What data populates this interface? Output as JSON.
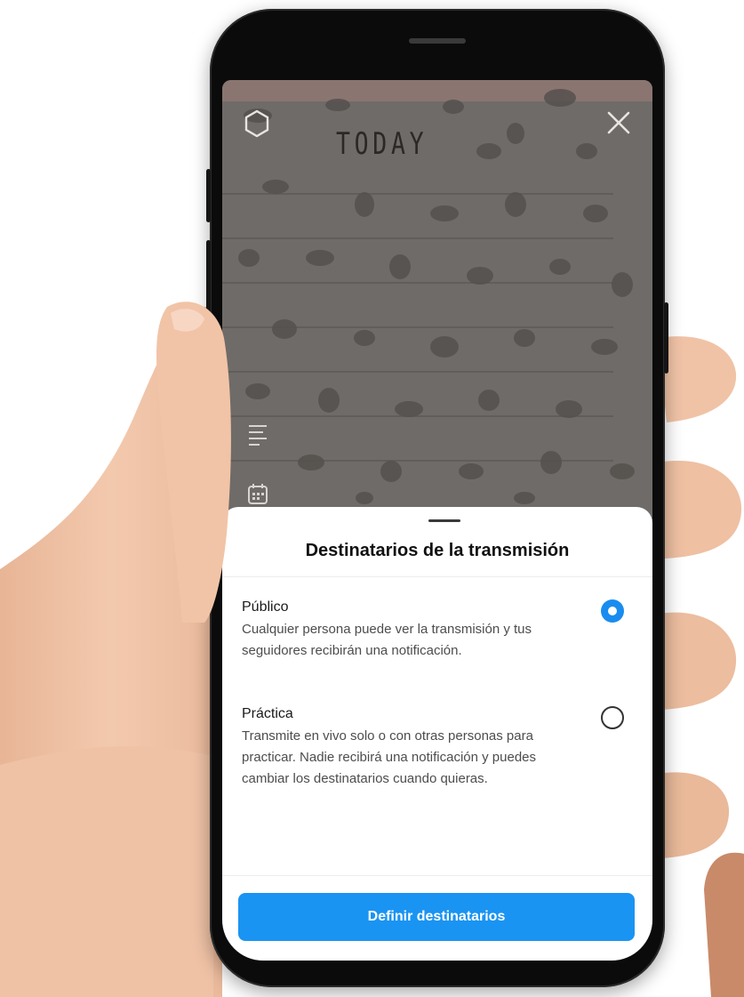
{
  "camera": {
    "notebook_heading": "TODAY",
    "settings_icon": "settings-gear-icon",
    "close_icon": "close-icon",
    "text_icon": "text-lines-icon",
    "calendar_icon": "calendar-icon"
  },
  "sheet": {
    "title": "Destinatarios de la transmisión",
    "options": [
      {
        "title": "Público",
        "description": "Cualquier persona puede ver la transmisión y tus seguidores recibirán una notificación.",
        "selected": true
      },
      {
        "title": "Práctica",
        "description": "Transmite en vivo solo o con otras personas para practicar. Nadie recibirá una notificación y puedes cambiar los destinatarios cuando quieras.",
        "selected": false
      }
    ],
    "button_label": "Definir destinatarios"
  },
  "colors": {
    "accent": "#1a94f2",
    "radio_selected": "#1a8cf0",
    "sheet_background": "#ffffff",
    "phone_body": "#0b0b0b",
    "skin": "#f0c3a6"
  }
}
